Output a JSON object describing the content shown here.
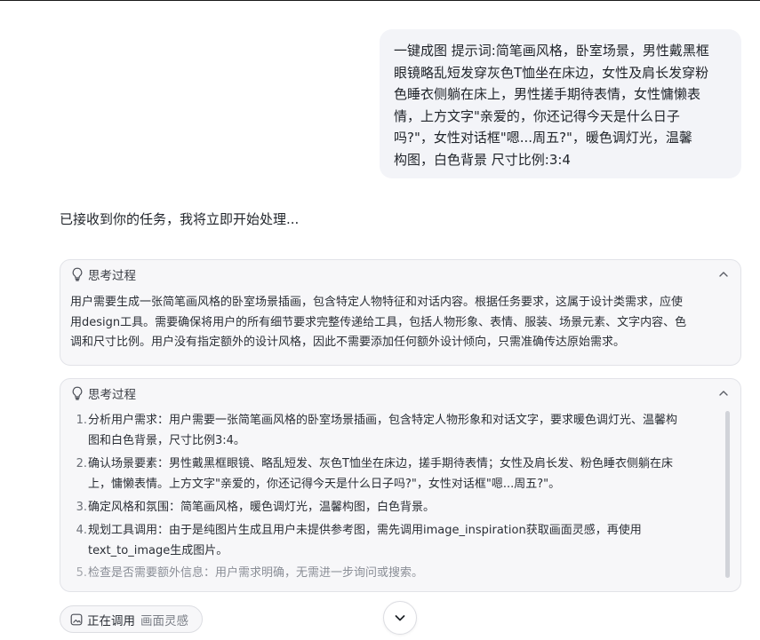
{
  "user_message": {
    "lines": [
      "一键成图 提示词:简笔画风格，卧室场景，男性戴黑框",
      "眼镜略乱短发穿灰色T恤坐在床边，女性及肩长发穿粉",
      "色睡衣侧躺在床上，男性搓手期待表情，女性慵懒表",
      "情，上方文字\"亲爱的，你还记得今天是什么日子",
      "吗?\"，女性对话框\"嗯...周五?\"，暖色调灯光，温馨",
      "构图，白色背景 尺寸比例:3:4"
    ]
  },
  "assistant": {
    "ack": "已接收到你的任务，我将立即开始处理..."
  },
  "thinking_1": {
    "title": "思考过程",
    "icon": "lightbulb-icon",
    "lines": [
      "用户需要生成一张简笔画风格的卧室场景插画，包含特定人物特征和对话内容。根据任务要求，这属于设计类需求，应使",
      "用design工具。需要确保将用户的所有细节要求完整传递给工具，包括人物形象、表情、服装、场景元素、文字内容、色",
      "调和尺寸比例。用户没有指定额外的设计风格，因此不需要添加任何额外设计倾向，只需准确传达原始需求。"
    ]
  },
  "thinking_2": {
    "title": "思考过程",
    "icon": "lightbulb-icon",
    "steps": [
      {
        "num": "1.",
        "lines": [
          "分析用户需求：用户需要一张简笔画风格的卧室场景插画，包含特定人物形象和对话文字，要求暖色调灯光、温馨构",
          "图和白色背景，尺寸比例3:4。"
        ]
      },
      {
        "num": "2.",
        "lines": [
          "确认场景要素：男性戴黑框眼镜、略乱短发、灰色T恤坐在床边，搓手期待表情；女性及肩长发、粉色睡衣侧躺在床",
          "上，慵懒表情。上方文字\"亲爱的，你还记得今天是什么日子吗?\"，女性对话框\"嗯...周五?\"。"
        ]
      },
      {
        "num": "3.",
        "lines": [
          "确定风格和氛围：简笔画风格，暖色调灯光，温馨构图，白色背景。"
        ]
      },
      {
        "num": "4.",
        "lines": [
          "规划工具调用：由于是纯图片生成且用户未提供参考图，需先调用image_inspiration获取画面灵感，再使用",
          "text_to_image生成图片。"
        ]
      },
      {
        "num": "5.",
        "lines": [
          "检查是否需要额外信息：用户需求明确，无需进一步询问或搜索。"
        ]
      }
    ]
  },
  "tool_call": {
    "status": "正在调用",
    "tool_name": "画面灵感",
    "icon": "image-icon"
  },
  "scroll_button": {
    "icon": "chevron-down-icon"
  }
}
